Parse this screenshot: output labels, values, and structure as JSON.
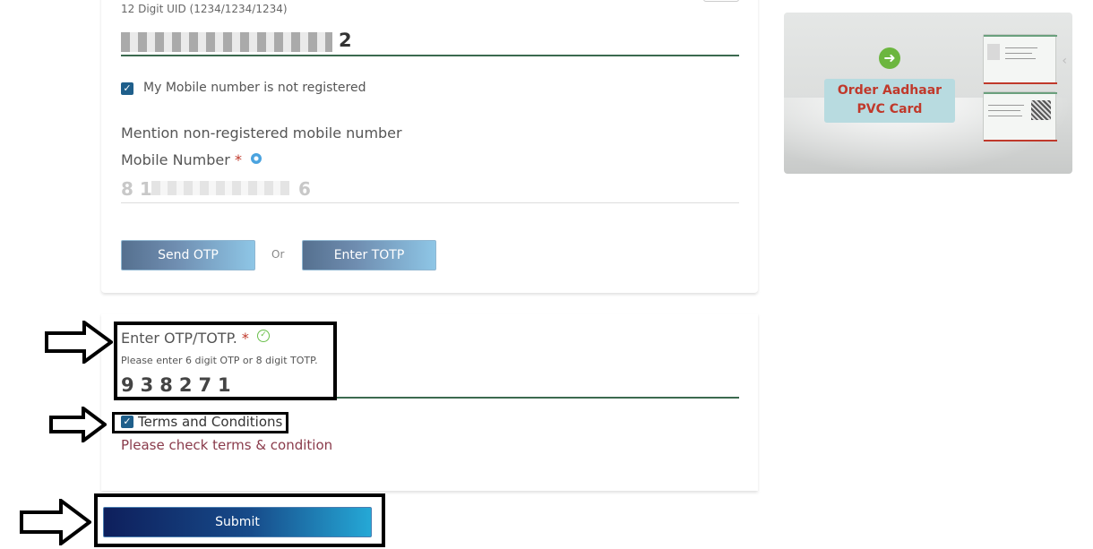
{
  "uid": {
    "hint": "12 Digit UID (1234/1234/1234)",
    "last_digit": "2"
  },
  "mobile_not_registered": {
    "label": "My Mobile number is not registered",
    "checked": true
  },
  "mobile": {
    "mention_text": "Mention non-registered mobile number",
    "label": "Mobile Number",
    "required_mark": "*",
    "first_digits": "8 1",
    "last_digit": "6"
  },
  "actions": {
    "send_otp": "Send OTP",
    "or": "Or",
    "enter_totp": "Enter TOTP"
  },
  "otp": {
    "label": "Enter OTP/TOTP.",
    "required_mark": "*",
    "hint": "Please enter 6 digit OTP or 8 digit TOTP.",
    "value": "938271"
  },
  "terms": {
    "label": "Terms and Conditions",
    "checked": true,
    "warning": "Please check terms & condition"
  },
  "submit": {
    "label": "Submit"
  },
  "promo": {
    "title_line1": "Order Aadhaar",
    "title_line2": "PVC Card"
  },
  "colors": {
    "otp_underline": "#3b6a4f",
    "checkbox": "#1f5f8b",
    "warning_text": "#8a3b4b",
    "submit_start": "#0e1f5c",
    "submit_end": "#25a8d6",
    "promo_text": "#c0392b"
  },
  "icons": {
    "checkbox": "checkmark-icon",
    "info": "info-icon",
    "valid": "check-circle-icon",
    "promo_arrow": "arrow-right-circle-icon"
  }
}
